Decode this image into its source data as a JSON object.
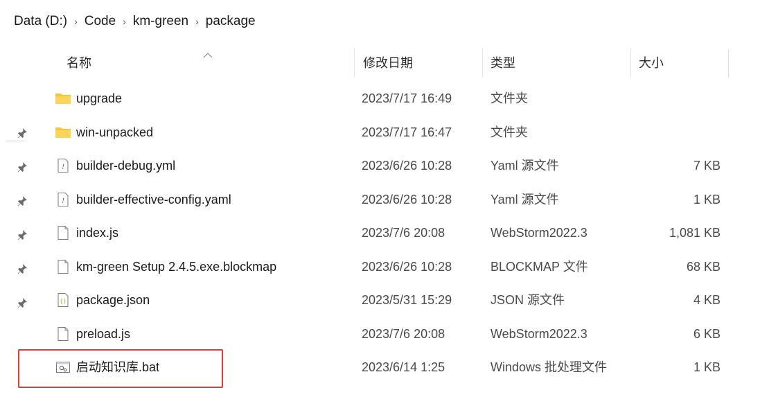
{
  "breadcrumb": {
    "items": [
      "Data (D:)",
      "Code",
      "km-green",
      "package"
    ],
    "separator": "›"
  },
  "columns": {
    "name": "名称",
    "date": "修改日期",
    "type": "类型",
    "size": "大小"
  },
  "files": [
    {
      "name": "upgrade",
      "date": "2023/7/17 16:49",
      "type": "文件夹",
      "size": "",
      "icon": "folder-icon"
    },
    {
      "name": "win-unpacked",
      "date": "2023/7/17 16:47",
      "type": "文件夹",
      "size": "",
      "icon": "folder-icon"
    },
    {
      "name": "builder-debug.yml",
      "date": "2023/6/26 10:28",
      "type": "Yaml 源文件",
      "size": "7 KB",
      "icon": "yaml-file-icon"
    },
    {
      "name": "builder-effective-config.yaml",
      "date": "2023/6/26 10:28",
      "type": "Yaml 源文件",
      "size": "1 KB",
      "icon": "yaml-file-icon"
    },
    {
      "name": "index.js",
      "date": "2023/7/6 20:08",
      "type": "WebStorm2022.3",
      "size": "1,081 KB",
      "icon": "file-icon"
    },
    {
      "name": "km-green Setup 2.4.5.exe.blockmap",
      "date": "2023/6/26 10:28",
      "type": "BLOCKMAP 文件",
      "size": "68 KB",
      "icon": "file-icon"
    },
    {
      "name": "package.json",
      "date": "2023/5/31 15:29",
      "type": "JSON 源文件",
      "size": "4 KB",
      "icon": "json-file-icon"
    },
    {
      "name": "preload.js",
      "date": "2023/7/6 20:08",
      "type": "WebStorm2022.3",
      "size": "6 KB",
      "icon": "file-icon"
    },
    {
      "name": "启动知识库.bat",
      "date": "2023/6/14 1:25",
      "type": "Windows 批处理文件",
      "size": "1 KB",
      "icon": "bat-file-icon"
    }
  ],
  "highlight_color": "#e53935",
  "folder_color": "#f8c53a"
}
